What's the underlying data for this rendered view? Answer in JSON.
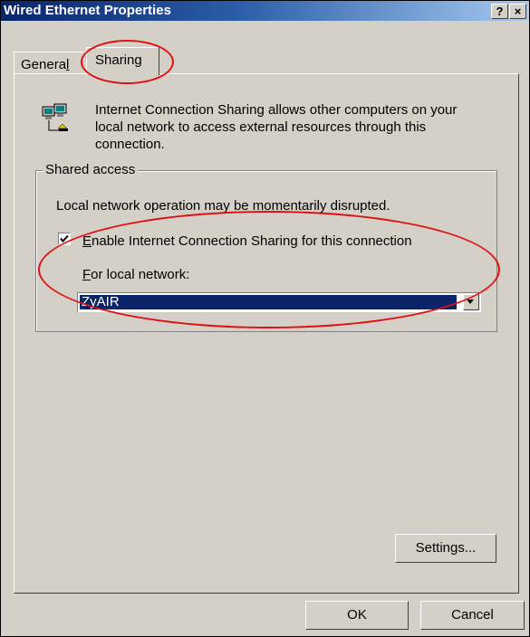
{
  "window": {
    "title": "Wired Ethernet Properties",
    "help_label": "?",
    "close_label": "×"
  },
  "tabs": [
    {
      "label": "Genera",
      "underline": "l",
      "selected": false
    },
    {
      "label": "Sharing",
      "selected": true
    }
  ],
  "sharing": {
    "description": "Internet Connection Sharing allows other computers on your local network to access external resources through this connection.",
    "desc_lines": [
      "Internet Connection Sharing allows other computers on your",
      "local network to access external resources through this",
      "connection."
    ],
    "group_label": "Shared access",
    "warning": "Local network operation may be momentarily disrupted.",
    "enable_checkbox": {
      "accel": "E",
      "rest": "nable Internet Connection Sharing for this connection",
      "checked": true
    },
    "local_network_label": {
      "accel": "F",
      "rest": "or local network:"
    },
    "local_network_value": "ZyAIR",
    "settings_button": "Settings..."
  },
  "buttons": {
    "ok": "OK",
    "cancel": "Cancel"
  },
  "colors": {
    "highlight_outline": "#e01010",
    "title_bar": "#0a246a",
    "face": "#d4d0c8"
  },
  "icons": {
    "network_sharing": "network-sharing-icon",
    "dropdown": "chevron-down-icon",
    "check": "check-icon"
  }
}
